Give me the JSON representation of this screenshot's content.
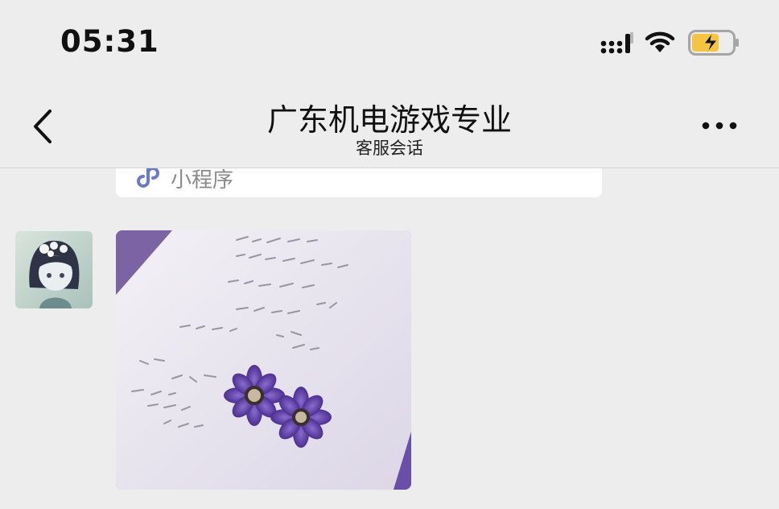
{
  "status_bar": {
    "time": "05:31"
  },
  "nav": {
    "title": "广东机电游戏专业",
    "subtitle": "客服会话"
  },
  "chat": {
    "card": {
      "miniprogram_label": "小程序"
    }
  },
  "colors": {
    "background": "#ededed",
    "battery_fill": "#f5c542",
    "card_bg": "#ffffff",
    "mp_icon": "#6b79c9",
    "photo_purple": "#6a4fa8"
  },
  "icons": [
    "signal-icon",
    "wifi-icon",
    "battery-charging-icon",
    "back-chevron-icon",
    "more-dots-icon",
    "miniprogram-icon"
  ]
}
